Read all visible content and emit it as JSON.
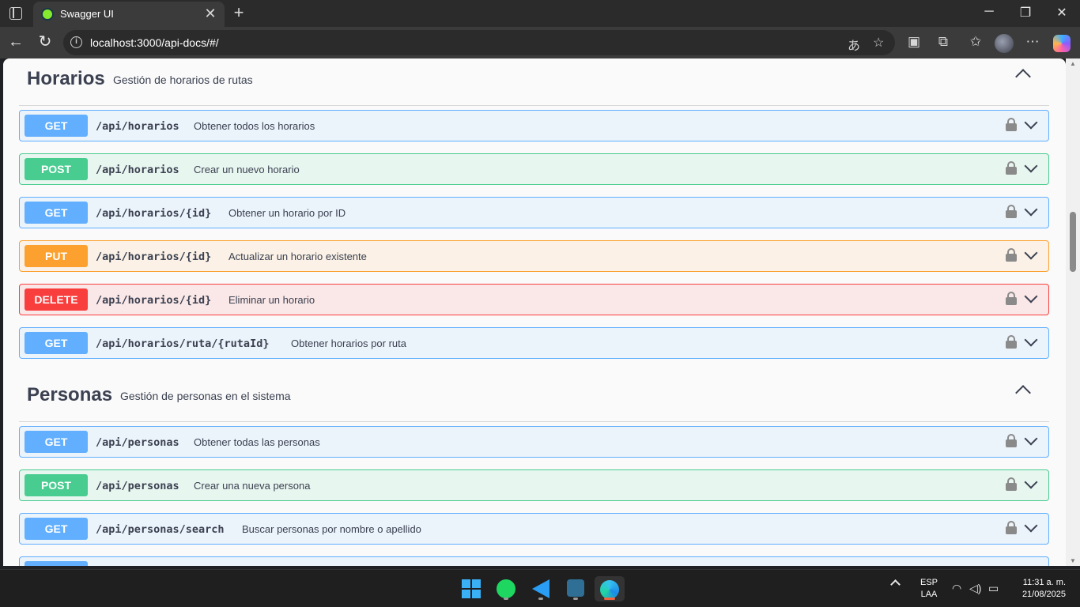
{
  "browser": {
    "tab_title": "Swagger UI",
    "tab_close": "✕",
    "new_tab": "+",
    "address": "localhost:3000/api-docs/#/",
    "icons": [
      "window-menu-icon",
      "swagger-favicon-icon",
      "back-icon",
      "reload-icon",
      "site-info-icon",
      "read-aloud-icon",
      "favorite-star-icon",
      "split-screen-icon",
      "extensions-icon",
      "favorites-icon",
      "profile-avatar",
      "more-icon",
      "copilot-icon"
    ]
  },
  "sections": [
    {
      "title": "Horarios",
      "description": "Gestión de horarios de rutas",
      "operations": [
        {
          "method": "GET",
          "path": "/api/horarios",
          "summary": "Obtener todos los horarios"
        },
        {
          "method": "POST",
          "path": "/api/horarios",
          "summary": "Crear un nuevo horario"
        },
        {
          "method": "GET",
          "path": "/api/horarios/{id}",
          "summary": "Obtener un horario por ID"
        },
        {
          "method": "PUT",
          "path": "/api/horarios/{id}",
          "summary": "Actualizar un horario existente"
        },
        {
          "method": "DELETE",
          "path": "/api/horarios/{id}",
          "summary": "Eliminar un horario"
        },
        {
          "method": "GET",
          "path": "/api/horarios/ruta/{rutaId}",
          "summary": "Obtener horarios por ruta"
        }
      ]
    },
    {
      "title": "Personas",
      "description": "Gestión de personas en el sistema",
      "operations": [
        {
          "method": "GET",
          "path": "/api/personas",
          "summary": "Obtener todas las personas"
        },
        {
          "method": "POST",
          "path": "/api/personas",
          "summary": "Crear una nueva persona"
        },
        {
          "method": "GET",
          "path": "/api/personas/search",
          "summary": "Buscar personas por nombre o apellido"
        }
      ]
    }
  ],
  "colors": {
    "get": "#61affe",
    "post": "#49cc90",
    "put": "#fca130",
    "delete": "#f93e3e",
    "text": "#3b4151"
  },
  "taskbar": {
    "apps": [
      "start-icon",
      "spotify-icon",
      "vscode-icon",
      "mysql-workbench-icon",
      "edge-icon"
    ],
    "lang_top": "ESP",
    "lang_bottom": "LAA",
    "time": "11:31 a. m.",
    "date": "21/08/2025"
  }
}
